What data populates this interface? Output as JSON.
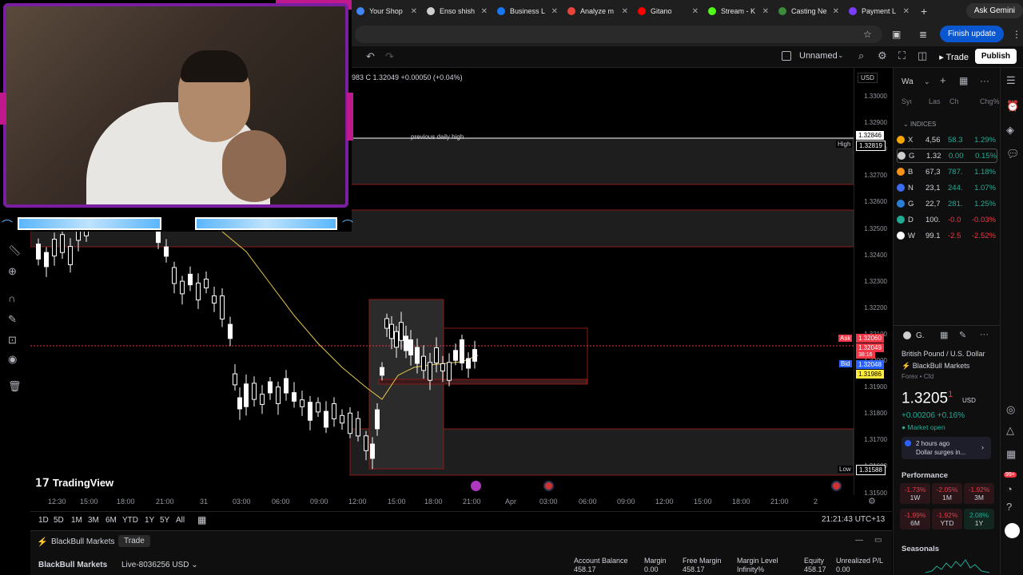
{
  "browser": {
    "tabs": [
      {
        "label": "Your Shop",
        "color": "#4285f4"
      },
      {
        "label": "Enso shish",
        "color": "#cfcfcf"
      },
      {
        "label": "Business L",
        "color": "#1877f2"
      },
      {
        "label": "Analyze m",
        "color": "#e8453c"
      },
      {
        "label": "Gitano",
        "color": "#ff0000"
      },
      {
        "label": "Stream - K",
        "color": "#53fc18"
      },
      {
        "label": "Casting Ne",
        "color": "#3c8c3c"
      },
      {
        "label": "Payment L",
        "color": "#7a3cff"
      }
    ],
    "new_tab": "+",
    "ask_gemini": "Ask Gemini",
    "finish_update": "Finish update"
  },
  "toolbar": {
    "layout_name": "Unnamed",
    "trade": "Trade",
    "publish": "Publish"
  },
  "legend": {
    "ohlc": "31983 C 1.32049 +0.00050 (+0.04%)"
  },
  "price_scale": {
    "currency": "USD",
    "ticks": [
      "1.33000",
      "1.32900",
      "1.32800",
      "1.32700",
      "1.32600",
      "1.32500",
      "1.32400",
      "1.32300",
      "1.32200",
      "1.32100",
      "1.32000",
      "1.31900",
      "1.31800",
      "1.31700",
      "1.31600",
      "1.31500"
    ],
    "high_label": "High",
    "high_price": "1.32819",
    "prev_high_price": "1.32846",
    "ask_label": "Ask",
    "ask_price": "1.32060",
    "last_price": "1.32049",
    "countdown": "38:16",
    "bid_label": "Bid",
    "bid_price": "1.32048",
    "ma_price": "1.31986",
    "low_label": "Low",
    "low_price": "1.31588"
  },
  "annotations": {
    "previous_daily_high": "previous daily high"
  },
  "watermark": "TradingView",
  "time_axis": [
    "12:30",
    "15:00",
    "18:00",
    "21:00",
    "31",
    "03:00",
    "06:00",
    "09:00",
    "12:00",
    "15:00",
    "18:00",
    "21:00",
    "Apr",
    "03:00",
    "06:00",
    "09:00",
    "12:00",
    "15:00",
    "18:00",
    "21:00",
    "2"
  ],
  "ranges": [
    "1D",
    "5D",
    "1M",
    "3M",
    "6M",
    "YTD",
    "1Y",
    "5Y",
    "All"
  ],
  "clock": "21:21:43 UTC+13",
  "broker": {
    "name": "BlackBull Markets",
    "trade_tab": "Trade",
    "account_name": "BlackBull Markets",
    "account_id": "Live-8036256 USD",
    "stats": [
      {
        "label": "Account Balance",
        "value": "458.17"
      },
      {
        "label": "Margin",
        "value": "0.00"
      },
      {
        "label": "Free Margin",
        "value": "458.17"
      },
      {
        "label": "Margin Level",
        "value": "Infinity%"
      },
      {
        "label": "Equity",
        "value": "458.17"
      },
      {
        "label": "Unrealized P/L",
        "value": "0.00"
      }
    ]
  },
  "watchlist": {
    "title": "Wa",
    "columns": [
      "Syı",
      "Las",
      "Ch",
      "Chg%"
    ],
    "section": "INDICES",
    "rows": [
      {
        "sym": "X",
        "last": "4,56",
        "chg": "58.3",
        "pct": "1.29%",
        "dir": "pos",
        "color": "#f7a600"
      },
      {
        "sym": "G",
        "last": "1.32",
        "chg": "0.00",
        "pct": "0.15%",
        "dir": "pos",
        "color": "#cfcfcf"
      },
      {
        "sym": "B",
        "last": "67,3",
        "chg": "787.",
        "pct": "1.18%",
        "dir": "pos",
        "color": "#f7931a"
      },
      {
        "sym": "N",
        "last": "23,1",
        "chg": "244.",
        "pct": "1.07%",
        "dir": "pos",
        "color": "#3c6df0"
      },
      {
        "sym": "G",
        "last": "22,7",
        "chg": "281.",
        "pct": "1.25%",
        "dir": "pos",
        "color": "#2a7fd4"
      },
      {
        "sym": "D",
        "last": "100.",
        "chg": "-0.0",
        "pct": "-0.03%",
        "dir": "neg",
        "color": "#22ab94"
      },
      {
        "sym": "W",
        "last": "99.1",
        "chg": "-2.5",
        "pct": "-2.52%",
        "dir": "neg",
        "color": "#ffffff"
      }
    ]
  },
  "details": {
    "symbol": "G.",
    "name": "British Pound / U.S. Dollar",
    "broker": "BlackBull Markets",
    "type": "Forex • Cfd",
    "price_main": "1.3205",
    "price_sup": "1",
    "currency": "USD",
    "change": "+0.00206",
    "change_pct": "+0.16%",
    "status": "Market open",
    "news_time": "2 hours ago",
    "news_text": "Dollar surges in..."
  },
  "performance": {
    "title": "Performance",
    "items": [
      {
        "value": "-1.73%",
        "period": "1W",
        "dir": "neg"
      },
      {
        "value": "-2.05%",
        "period": "1M",
        "dir": "neg"
      },
      {
        "value": "-1.92%",
        "period": "3M",
        "dir": "neg"
      },
      {
        "value": "-1.99%",
        "period": "6M",
        "dir": "neg"
      },
      {
        "value": "-1.92%",
        "period": "YTD",
        "dir": "neg"
      },
      {
        "value": "2.08%",
        "period": "1Y",
        "dir": "pos"
      }
    ],
    "seasonals": "Seasonals"
  },
  "notification_badge": "99+"
}
